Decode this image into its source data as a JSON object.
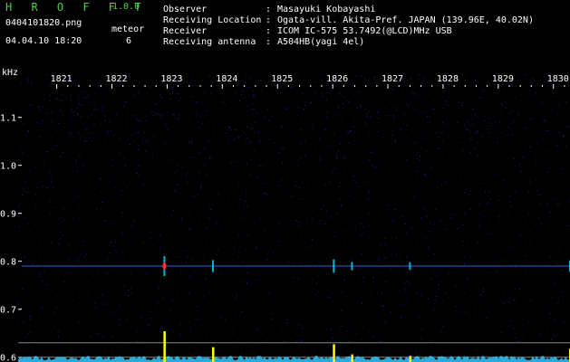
{
  "header": {
    "app_name": "H R O F F T",
    "version": "1.0.0",
    "filename": "0404101820.png",
    "meteor_label": "meteor",
    "datetime": "04.04.10 18:20",
    "meteor_count": "6"
  },
  "info": [
    {
      "label": "Observer",
      "value": "Masayuki Kobayashi"
    },
    {
      "label": "Receiving Location",
      "value": "Ogata-vill. Akita-Pref. JAPAN (139.96E, 40.02N)"
    },
    {
      "label": "Receiver",
      "value": "ICOM IC-575 53.7492(@LCD)MHz USB"
    },
    {
      "label": "Receiving antenna",
      "value": "A504HB(yagi 4el)"
    }
  ],
  "colors": {
    "background": "#000000",
    "title": "#46d246",
    "axis": "#ffffff",
    "noise": "#2a2ad8",
    "echo_line": "#3a7aff",
    "meteor_center": "#ff3030",
    "meteor_glow": "#00e0ff",
    "peak": "#ffff00",
    "activity": "#30c8ff"
  },
  "chart_data": {
    "type": "heatmap",
    "ylabel": "kHz",
    "x_ticks": [
      "1821",
      "1822",
      "1823",
      "1824",
      "1825",
      "1826",
      "1827",
      "1828",
      "1829",
      "1830"
    ],
    "y_ticks": [
      "1.1",
      "1.0",
      "0.9",
      "0.8",
      "0.7",
      "0.6"
    ],
    "xlim": [
      1820.3,
      1830.3
    ],
    "ylim": [
      0.59,
      1.19
    ],
    "echo_band_khz": 0.79,
    "meteors": [
      {
        "minute": 1822.95,
        "strength": 1.0
      },
      {
        "minute": 1823.83,
        "strength": 0.45
      },
      {
        "minute": 1826.02,
        "strength": 0.55
      },
      {
        "minute": 1826.35,
        "strength": 0.2
      },
      {
        "minute": 1827.4,
        "strength": 0.15
      },
      {
        "minute": 1830.3,
        "strength": 0.4
      }
    ]
  }
}
